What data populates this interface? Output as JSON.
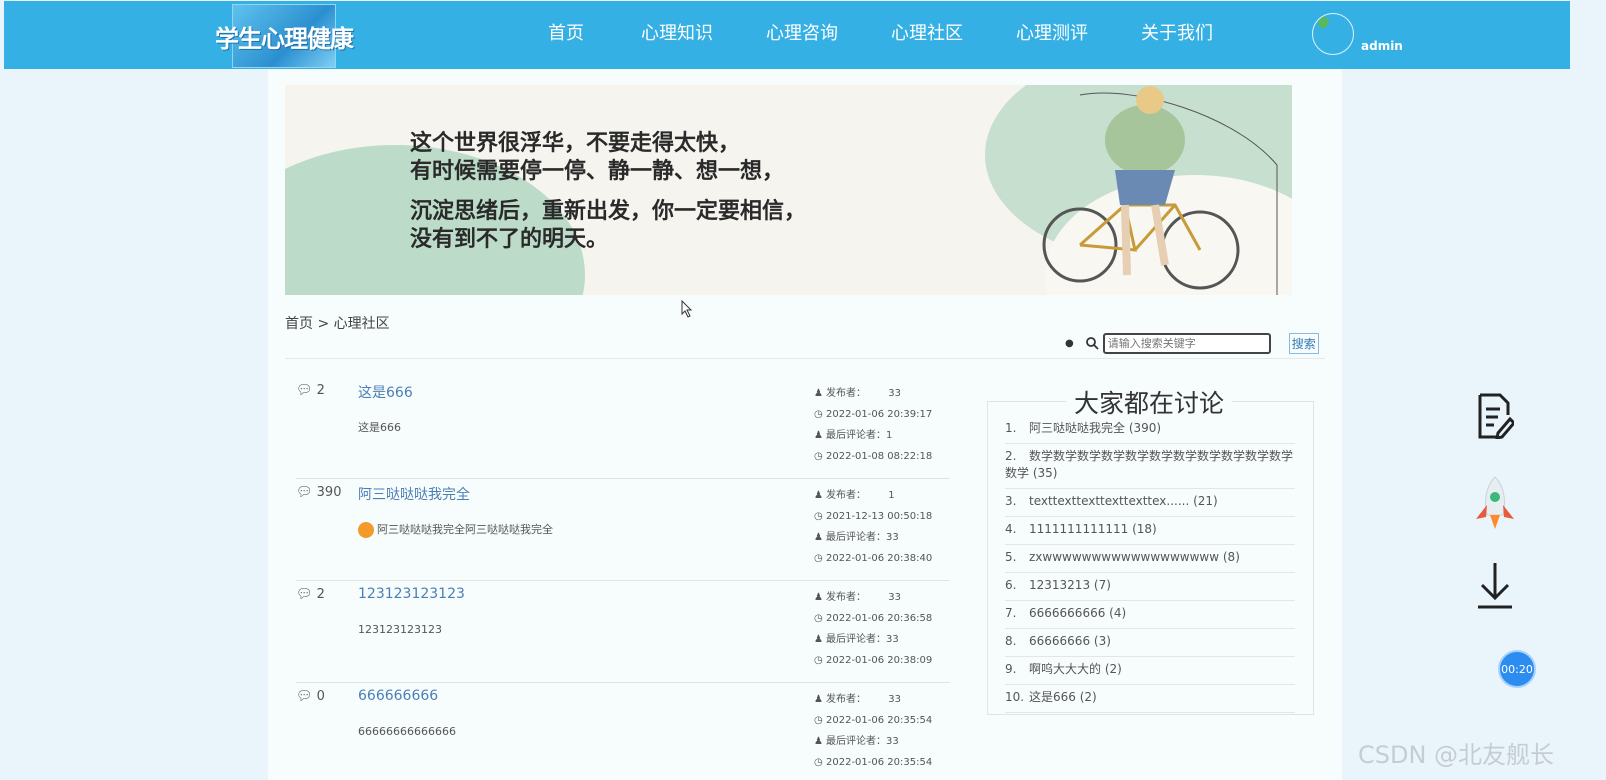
{
  "header": {
    "logo_text": "学生心理健康",
    "nav": [
      "首页",
      "心理知识",
      "心理咨询",
      "心理社区",
      "心理测评",
      "关于我们"
    ],
    "username": "admin"
  },
  "banner": {
    "lines": [
      "这个世界很浮华，不要走得太快，",
      "有时候需要停一停、静一静、想一想，",
      "沉淀思绪后，重新出发，你一定要相信，",
      "没有到不了的明天。"
    ]
  },
  "breadcrumb": "首页 >  心理社区",
  "search": {
    "placeholder": "请输入搜索关键字",
    "button": "搜索"
  },
  "meta_labels": {
    "publisher": "发布者：",
    "last_commenter": "最后评论者："
  },
  "posts": [
    {
      "count": "2",
      "title": "这是666",
      "excerpt": "这是666",
      "publisher": "33",
      "published": "2022-01-06 20:39:17",
      "last_commenter": "1",
      "last_time": "2022-01-08 08:22:18",
      "emoji": false
    },
    {
      "count": "390",
      "title": "阿三哒哒哒我完全",
      "excerpt": "阿三哒哒哒我完全阿三哒哒哒我完全",
      "publisher": "1",
      "published": "2021-12-13 00:50:18",
      "last_commenter": "33",
      "last_time": "2022-01-06 20:38:40",
      "emoji": true
    },
    {
      "count": "2",
      "title": "123123123123",
      "excerpt": "123123123123",
      "publisher": "33",
      "published": "2022-01-06 20:36:58",
      "last_commenter": "33",
      "last_time": "2022-01-06 20:38:09",
      "emoji": false
    },
    {
      "count": "0",
      "title": "666666666",
      "excerpt": "66666666666666",
      "publisher": "33",
      "published": "2022-01-06 20:35:54",
      "last_commenter": "33",
      "last_time": "2022-01-06 20:35:54",
      "emoji": false
    }
  ],
  "discuss": {
    "title": "大家都在讨论",
    "items": [
      {
        "num": "1.",
        "text": "阿三哒哒哒我完全  (390)"
      },
      {
        "num": "2.",
        "text": "数学数学数学数学数学数学数学数学数学数学数学数学  (35)"
      },
      {
        "num": "3.",
        "text": "texttexttexttexttexttex......  (21)"
      },
      {
        "num": "4.",
        "text": "1111111111111  (18)"
      },
      {
        "num": "5.",
        "text": "zxwwwwwwwwwwwwwwwwww  (8)"
      },
      {
        "num": "6.",
        "text": "12313213  (7)"
      },
      {
        "num": "7.",
        "text": "6666666666  (4)"
      },
      {
        "num": "8.",
        "text": "66666666  (3)"
      },
      {
        "num": "9.",
        "text": "啊呜大大大的  (2)"
      },
      {
        "num": "10.",
        "text": "这是666  (2)"
      }
    ]
  },
  "timer": "00:20",
  "watermark": "CSDN @北友舰长"
}
